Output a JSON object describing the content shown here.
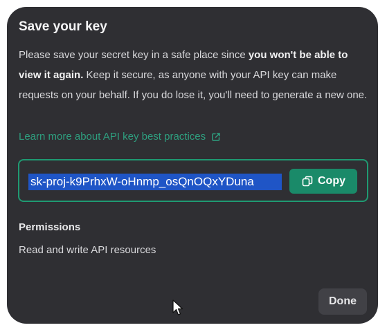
{
  "dialog": {
    "title": "Save your key",
    "description_parts": [
      "Please save your secret key in a safe place since ",
      "you won't be able to view it again.",
      " Keep it secure, as anyone with your API key can make requests on your behalf. If you do lose it, you'll need to generate a new one."
    ],
    "learn_more_link": "Learn more about API key best practices",
    "learn_more_icon": "external-link-icon",
    "secret_key": "sk-proj-k9PrhxW-oHnmp_osQnOQxYDuna",
    "copy_button_label": "Copy",
    "copy_icon": "copy-icon",
    "permissions_heading": "Permissions",
    "permissions_value": "Read and write API resources",
    "done_button_label": "Done"
  },
  "colors": {
    "dialog_background": "#2f2f33",
    "accent_green": "#1a8a69",
    "link_green": "#2e9f7f",
    "selection_blue": "#1f55c6"
  }
}
